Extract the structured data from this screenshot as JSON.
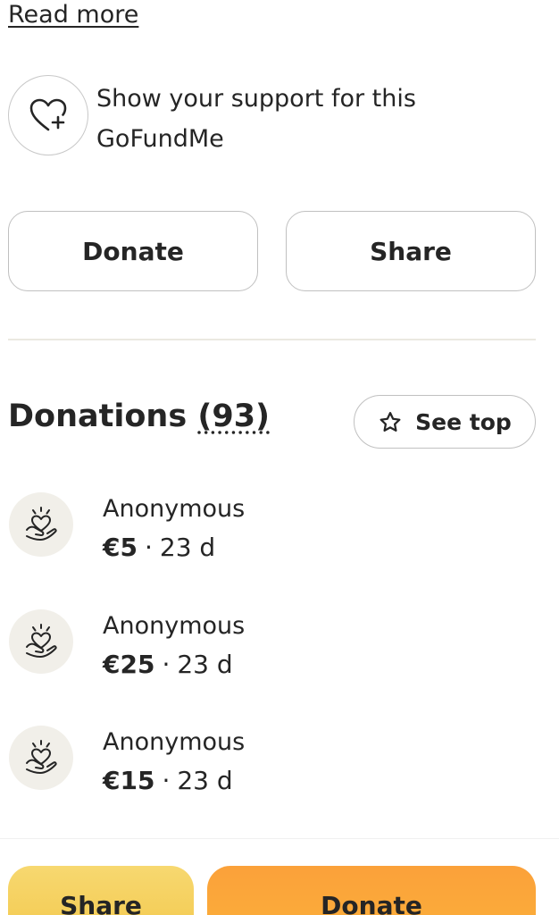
{
  "story": {
    "read_more": "Read more"
  },
  "support": {
    "text": "Show your support for this GoFundMe",
    "icon": "heart-plus-icon"
  },
  "actions": {
    "donate_label": "Donate",
    "share_label": "Share"
  },
  "donations": {
    "title": "Donations",
    "count": "(93)",
    "see_top_label": "See top",
    "items": [
      {
        "name": "Anonymous",
        "amount": "€5",
        "time": "23 d"
      },
      {
        "name": "Anonymous",
        "amount": "€25",
        "time": "23 d"
      },
      {
        "name": "Anonymous",
        "amount": "€15",
        "time": "23 d"
      }
    ]
  },
  "bottom_bar": {
    "share_label": "Share",
    "donate_label": "Donate"
  },
  "colors": {
    "share_yellow": "#f5d05c",
    "donate_orange": "#fba63a",
    "avatar_bg": "#f1efe9"
  }
}
